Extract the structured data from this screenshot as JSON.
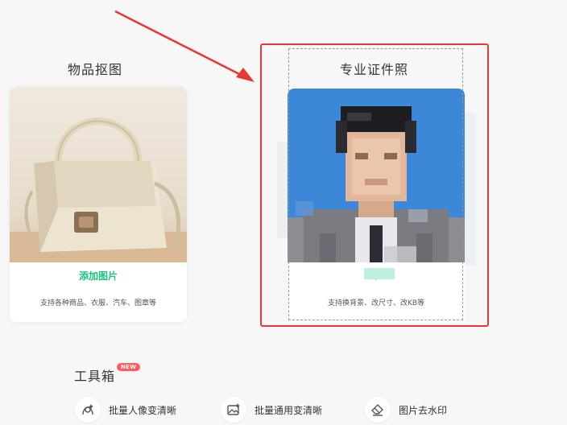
{
  "cards": {
    "object_cutout": {
      "title": "物品抠图",
      "link_label": "添加图片",
      "description": "支持各种商品、衣服、汽车、图章等"
    },
    "id_photo": {
      "title": "专业证件照",
      "link_label": "添",
      "description": "支持换背景、改尺寸、改KB等"
    }
  },
  "toolbox": {
    "title": "工具箱",
    "badge": "NEW",
    "tools": [
      {
        "label": "批量人像变清晰",
        "icon": "portrait-enhance-icon"
      },
      {
        "label": "批量通用变清晰",
        "icon": "image-enhance-icon"
      },
      {
        "label": "图片去水印",
        "icon": "eraser-icon"
      }
    ]
  },
  "colors": {
    "accent_green": "#1bc47d",
    "highlight_red": "#e53935",
    "id_photo_bg": "#3c87d8",
    "badge_red": "#ff5a5f"
  }
}
